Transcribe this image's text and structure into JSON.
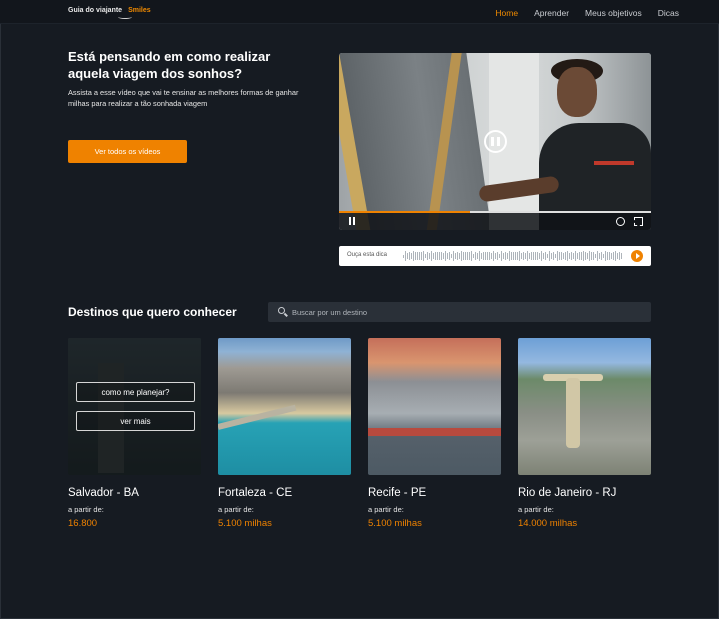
{
  "header": {
    "logo_text": "Guia do viajante",
    "logo_brand": "Smiles",
    "nav": [
      {
        "label": "Home",
        "active": true
      },
      {
        "label": "Aprender",
        "active": false
      },
      {
        "label": "Meus objetivos",
        "active": false
      },
      {
        "label": "Dicas",
        "active": false
      }
    ]
  },
  "hero": {
    "title": "Está pensando em como realizar aquela viagem dos sonhos?",
    "subtitle": "Assista a esse vídeo que vai te ensinar as melhores formas de ganhar milhas para realizar a tão sonhada viagem",
    "cta_label": "Ver todos os vídeos",
    "video_progress": 0.42
  },
  "audio": {
    "label": "Ouça esta dica"
  },
  "destinations": {
    "title": "Destinos que quero conhecer",
    "search_placeholder": "Buscar por um destino",
    "overlay_plan_label": "como me planejar?",
    "overlay_more_label": "ver mais",
    "cards": [
      {
        "name": "Salvador - BA",
        "from_label": "a partir de:",
        "price": "16.800"
      },
      {
        "name": "Fortaleza - CE",
        "from_label": "a partir de:",
        "price": "5.100 milhas"
      },
      {
        "name": "Recife - PE",
        "from_label": "a partir de:",
        "price": "5.100 milhas"
      },
      {
        "name": "Rio de Janeiro - RJ",
        "from_label": "a partir de:",
        "price": "14.000 milhas"
      }
    ]
  },
  "colors": {
    "background": "#161b22",
    "accent": "#ef8200",
    "text": "#ffffff"
  }
}
